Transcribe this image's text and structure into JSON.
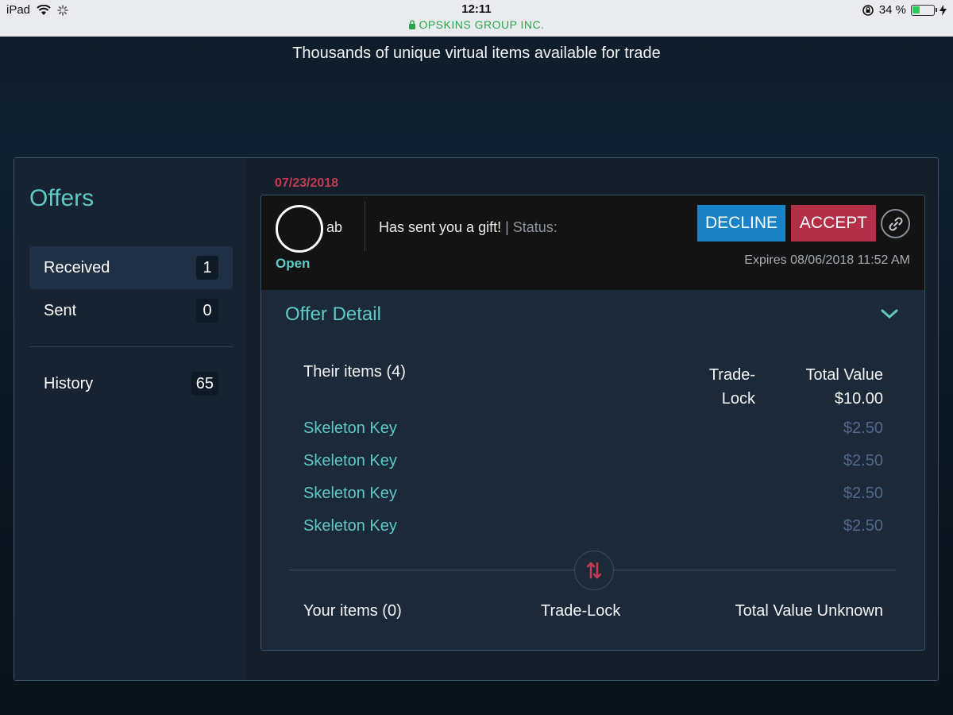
{
  "statusbar": {
    "device": "iPad",
    "time": "12:11",
    "site": "OPSKINS GROUP INC.",
    "battery": "34 %",
    "battery_level": 0.34
  },
  "tagline": "Thousands of unique virtual items available for trade",
  "sidebar": {
    "title": "Offers",
    "items": [
      {
        "label": "Received",
        "count": "1"
      },
      {
        "label": "Sent",
        "count": "0"
      },
      {
        "label": "History",
        "count": "65"
      }
    ]
  },
  "offer": {
    "date": "07/23/2018",
    "user": "ab",
    "state": "Open",
    "message": "Has sent you a gift!",
    "status_label": "| Status:",
    "decline_label": "DECLINE",
    "accept_label": "ACCEPT",
    "expires": "Expires 08/06/2018 11:52 AM",
    "detail_title": "Offer Detail",
    "their_items_label": "Their items (4)",
    "trade_lock_label": "Trade-Lock",
    "total_value_label": "Total Value",
    "total_value": "$10.00",
    "items": [
      {
        "name": "Skeleton Key",
        "price": "$2.50"
      },
      {
        "name": "Skeleton Key",
        "price": "$2.50"
      },
      {
        "name": "Skeleton Key",
        "price": "$2.50"
      },
      {
        "name": "Skeleton Key",
        "price": "$2.50"
      }
    ],
    "your_items_label": "Your items (0)",
    "your_trade_lock_label": "Trade-Lock",
    "your_total_label": "Total Value Unknown"
  },
  "colors": {
    "accent": "#5fc9c4",
    "decline": "#1a82c6",
    "accept": "#b22f47",
    "date": "#c23b52"
  },
  "icons": [
    "wifi-icon",
    "loading-icon",
    "lock-icon",
    "orientation-lock-icon",
    "battery-icon",
    "charging-icon",
    "link-icon",
    "chevron-down-icon",
    "swap-icon"
  ]
}
